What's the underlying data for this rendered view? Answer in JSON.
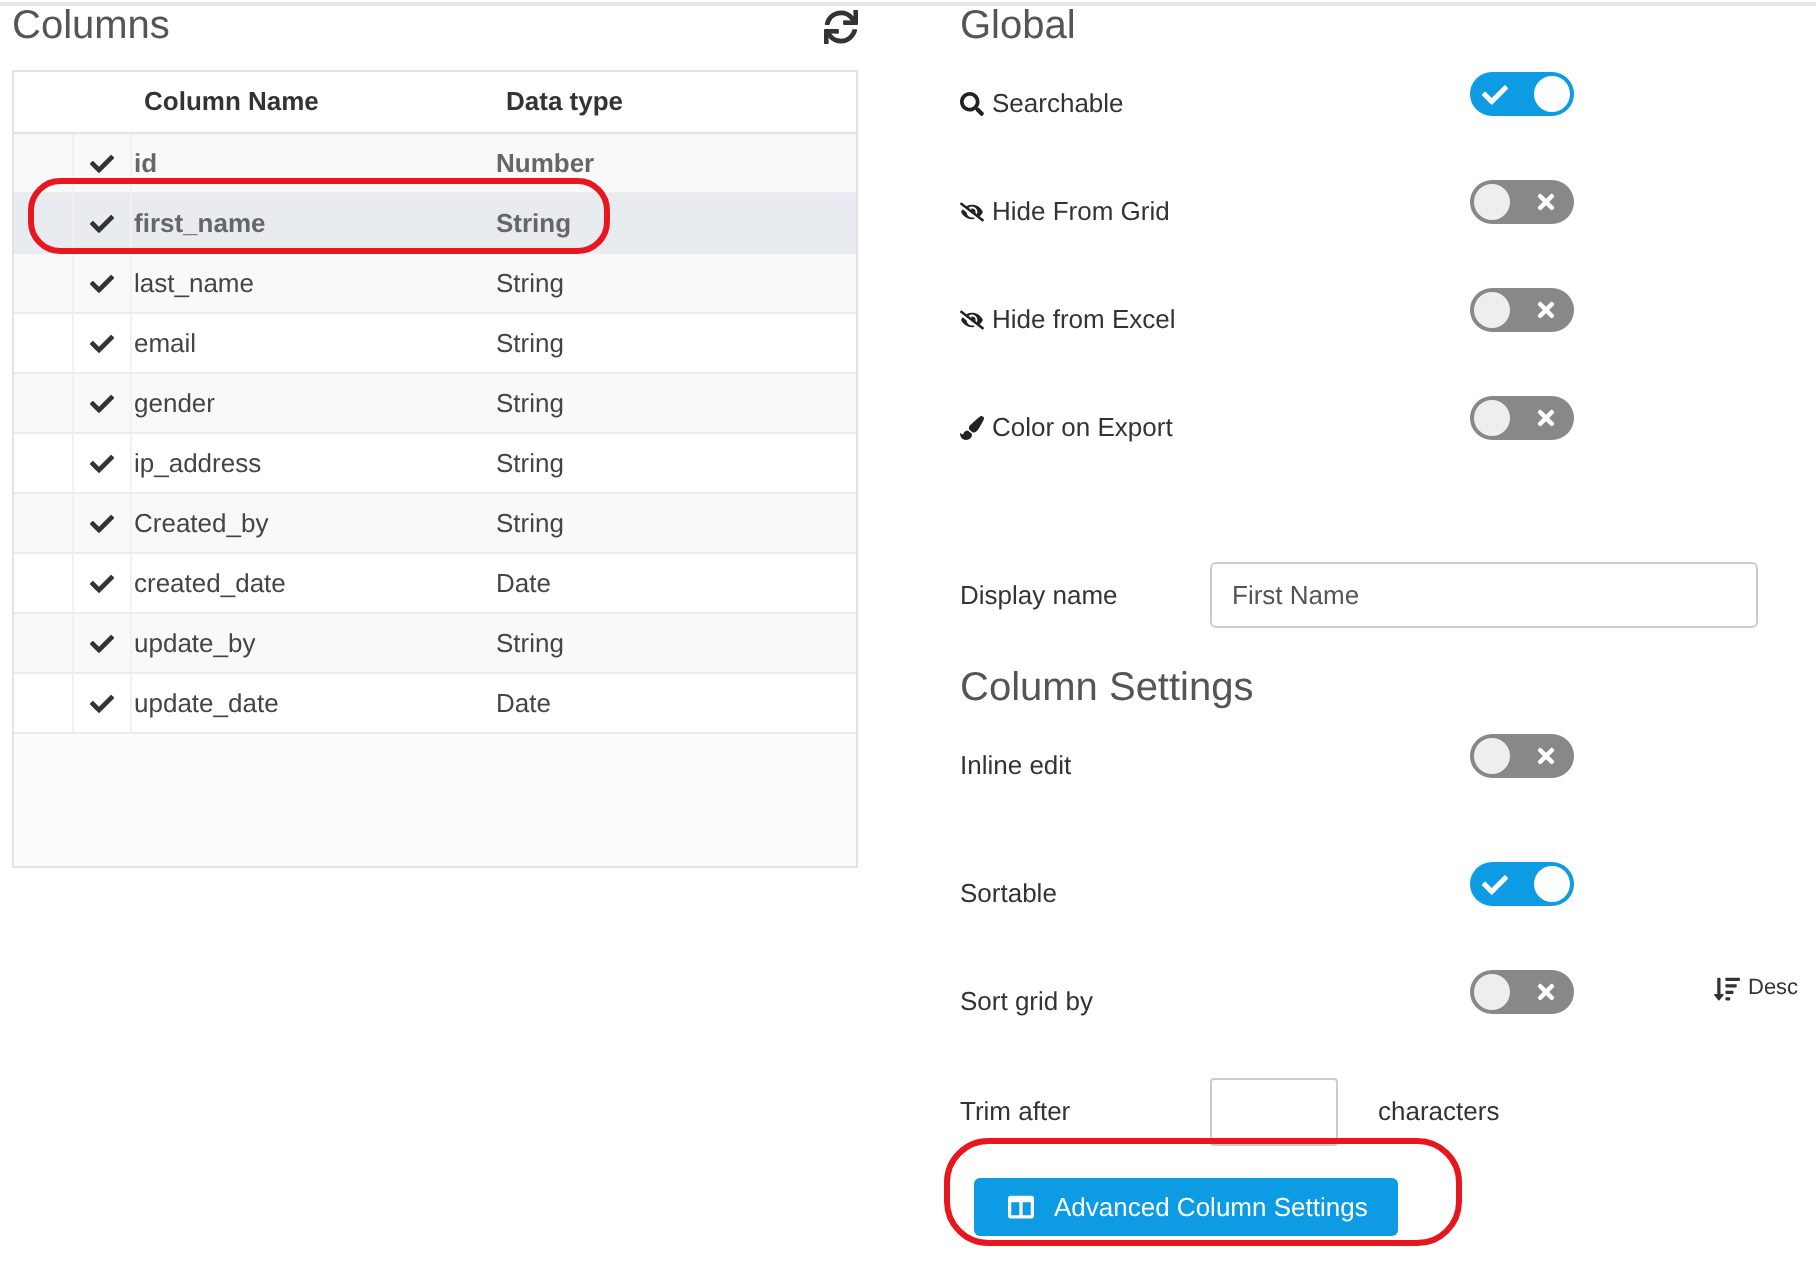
{
  "columns_panel": {
    "title": "Columns",
    "table": {
      "columns": [
        "Column Name",
        "Data type"
      ],
      "rows": [
        {
          "name": "id",
          "type": "Number",
          "checked": true,
          "selected": false,
          "bold": true,
          "circled": false
        },
        {
          "name": "first_name",
          "type": "String",
          "checked": true,
          "selected": true,
          "bold": true,
          "circled": true
        },
        {
          "name": "last_name",
          "type": "String",
          "checked": true,
          "selected": false,
          "bold": false,
          "circled": false
        },
        {
          "name": "email",
          "type": "String",
          "checked": true,
          "selected": false,
          "bold": false,
          "circled": false
        },
        {
          "name": "gender",
          "type": "String",
          "checked": true,
          "selected": false,
          "bold": false,
          "circled": false
        },
        {
          "name": "ip_address",
          "type": "String",
          "checked": true,
          "selected": false,
          "bold": false,
          "circled": false
        },
        {
          "name": "Created_by",
          "type": "String",
          "checked": true,
          "selected": false,
          "bold": false,
          "circled": false
        },
        {
          "name": "created_date",
          "type": "Date",
          "checked": true,
          "selected": false,
          "bold": false,
          "circled": false
        },
        {
          "name": "update_by",
          "type": "String",
          "checked": true,
          "selected": false,
          "bold": false,
          "circled": false
        },
        {
          "name": "update_date",
          "type": "Date",
          "checked": true,
          "selected": false,
          "bold": false,
          "circled": false
        }
      ]
    }
  },
  "global": {
    "title": "Global",
    "rows": [
      {
        "label": "Searchable",
        "on": true
      },
      {
        "label": "Hide From Grid",
        "on": false
      },
      {
        "label": "Hide from Excel",
        "on": false
      },
      {
        "label": "Color on Export",
        "on": false
      }
    ]
  },
  "display_name": {
    "label": "Display name",
    "value": "First Name"
  },
  "column_settings": {
    "title": "Column Settings",
    "rows": [
      {
        "kind": "toggle",
        "label": "Inline edit",
        "on": false
      },
      {
        "kind": "toggle",
        "label": "Sortable",
        "on": true
      },
      {
        "kind": "toggle",
        "label": "Sort grid by",
        "on": false,
        "order": "Desc"
      },
      {
        "kind": "number",
        "label": "Trim after",
        "suffix": "characters"
      }
    ]
  },
  "advanced_button": {
    "label": "Advanced Column Settings",
    "circled": true
  }
}
